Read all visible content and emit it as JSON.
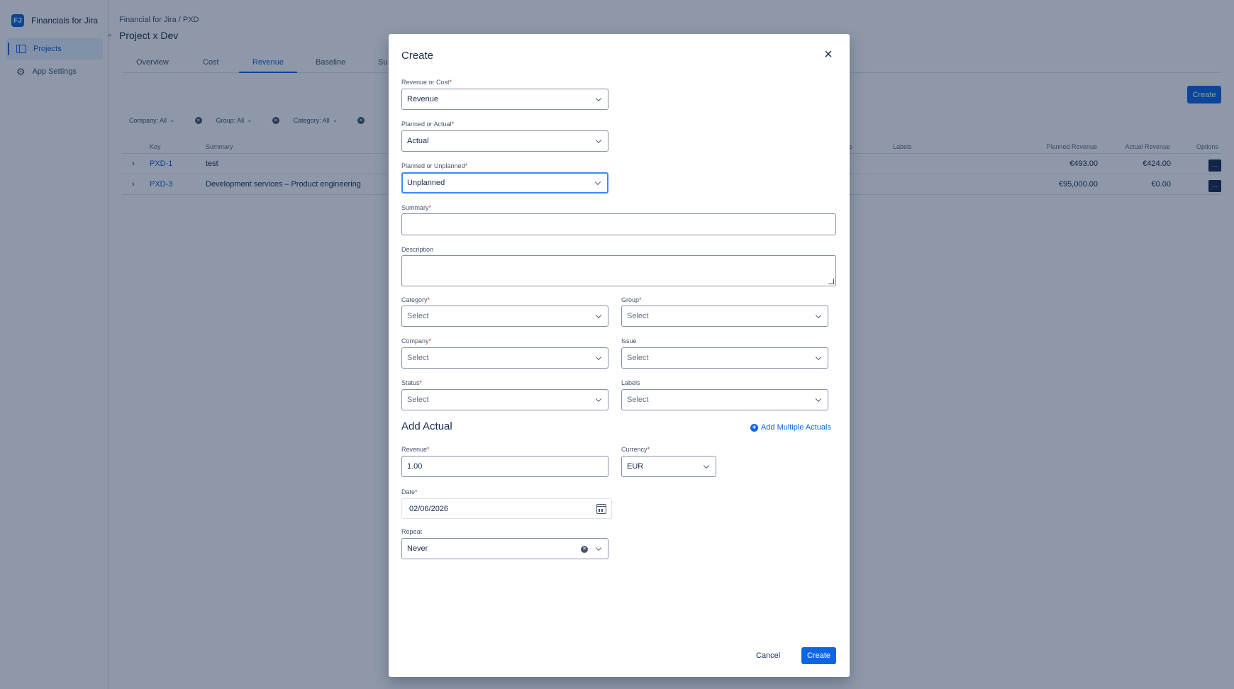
{
  "app": {
    "name": "Financials for Jira",
    "logo": "FJ",
    "nav": [
      {
        "label": "Projects",
        "icon": "board-icon",
        "active": true
      },
      {
        "label": "App Settings",
        "icon": "gear-icon",
        "active": false
      }
    ]
  },
  "page": {
    "breadcrumb": "Financial for Jira  / PXD",
    "title": "Project x Dev",
    "tabs": [
      "Overview",
      "Cost",
      "Revenue",
      "Baseline",
      "Su"
    ],
    "active_tab": "Revenue",
    "create_label": "Create"
  },
  "filters": [
    {
      "label": "Company: All"
    },
    {
      "label": "Group: All"
    },
    {
      "label": "Category: All"
    }
  ],
  "table": {
    "headers": {
      "key": "Key",
      "summary": "Summary",
      "e": "e",
      "labels": "Labels",
      "planned": "Planned Revenue",
      "actual": "Actual Revenue",
      "options": "Options"
    },
    "rows": [
      {
        "key": "PXD-1",
        "summary": "test",
        "planned": "€493.00",
        "actual": "€424.00"
      },
      {
        "key": "PXD-3",
        "summary": "Development services – Product engineering",
        "planned": "€95,000.00",
        "actual": "€0.00"
      }
    ]
  },
  "modal": {
    "title": "Create",
    "revenue_or_cost": {
      "label": "Revenue or Cost",
      "value": "Revenue"
    },
    "planned_or_actual": {
      "label": "Planned or Actual",
      "value": "Actual"
    },
    "planned_or_unplanned": {
      "label": "Planned or Unplanned",
      "value": "Unplanned"
    },
    "summary": {
      "label": "Summary",
      "value": ""
    },
    "description": {
      "label": "Description",
      "value": ""
    },
    "category": {
      "label": "Category",
      "placeholder": "Select"
    },
    "group": {
      "label": "Group",
      "placeholder": "Select"
    },
    "company": {
      "label": "Company",
      "placeholder": "Select"
    },
    "issue": {
      "label": "Issue",
      "placeholder": "Select"
    },
    "status": {
      "label": "Status",
      "placeholder": "Select"
    },
    "labels": {
      "label": "Labels",
      "placeholder": "Select"
    },
    "section_title": "Add Actual",
    "add_multiple": "Add Multiple Actuals",
    "revenue": {
      "label": "Revenue",
      "value": "1.00"
    },
    "currency": {
      "label": "Currency",
      "value": "EUR"
    },
    "date": {
      "label": "Date",
      "value": "02/06/2026"
    },
    "repeat": {
      "label": "Repeat",
      "value": "Never"
    },
    "cancel_label": "Cancel",
    "create_label": "Create",
    "required_mark": "*"
  },
  "colors": {
    "accent": "#0c66e4",
    "required": "#c9372c",
    "overlay": "rgba(9,30,66,0.46)"
  }
}
